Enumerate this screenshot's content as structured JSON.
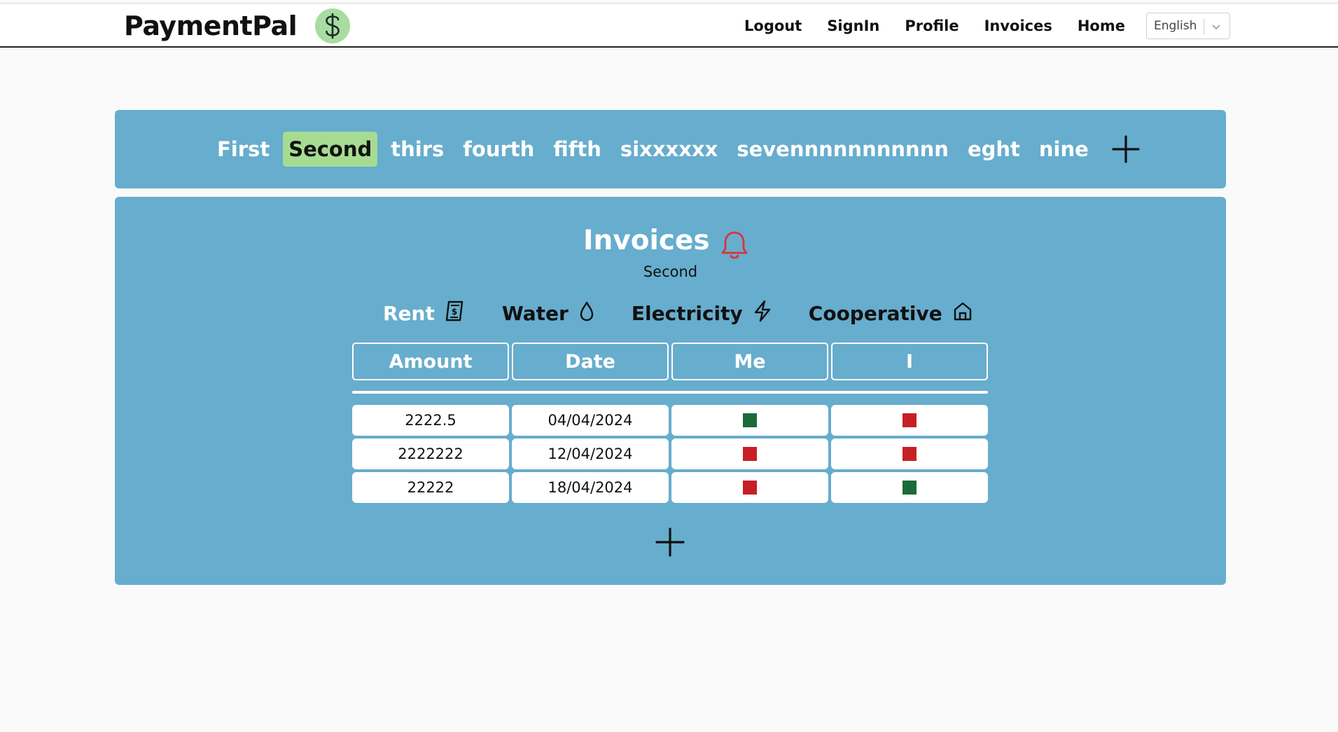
{
  "brand": {
    "name": "PaymentPal",
    "logo_icon": "dollar-icon",
    "logo_bg": "#a9dca1"
  },
  "nav": {
    "items": [
      {
        "label": "Logout"
      },
      {
        "label": "SignIn"
      },
      {
        "label": "Profile"
      },
      {
        "label": "Invoices"
      },
      {
        "label": "Home"
      }
    ],
    "language": {
      "selected": "English"
    }
  },
  "groups": {
    "tabs": [
      {
        "label": "First",
        "active": false
      },
      {
        "label": "Second",
        "active": true
      },
      {
        "label": "thirs",
        "active": false
      },
      {
        "label": "fourth",
        "active": false
      },
      {
        "label": "fifth",
        "active": false
      },
      {
        "label": "sixxxxxx",
        "active": false
      },
      {
        "label": "sevennnnnnnnnnn",
        "active": false
      },
      {
        "label": "eght",
        "active": false
      },
      {
        "label": "nine",
        "active": false
      }
    ],
    "add_icon": "plus-icon"
  },
  "invoices": {
    "title": "Invoices",
    "subtitle": "Second",
    "bell_icon": "bell-icon",
    "bell_color": "#d9333a",
    "categories": [
      {
        "label": "Rent",
        "icon": "receipt-dollar-icon",
        "active": true
      },
      {
        "label": "Water",
        "icon": "droplet-icon",
        "active": false
      },
      {
        "label": "Electricity",
        "icon": "lightning-icon",
        "active": false
      },
      {
        "label": "Cooperative",
        "icon": "home-icon",
        "active": false
      }
    ],
    "columns": [
      "Amount",
      "Date",
      "Me",
      "I"
    ],
    "rows": [
      {
        "amount": "2222.5",
        "date": "04/04/2024",
        "me": "paid",
        "i": "unpaid"
      },
      {
        "amount": "2222222",
        "date": "12/04/2024",
        "me": "unpaid",
        "i": "unpaid"
      },
      {
        "amount": "22222",
        "date": "18/04/2024",
        "me": "unpaid",
        "i": "paid"
      }
    ],
    "status_colors": {
      "paid": "#1b6b3a",
      "unpaid": "#c62026"
    }
  },
  "colors": {
    "panel": "#67adcd",
    "active_tab": "#a6dc92"
  }
}
